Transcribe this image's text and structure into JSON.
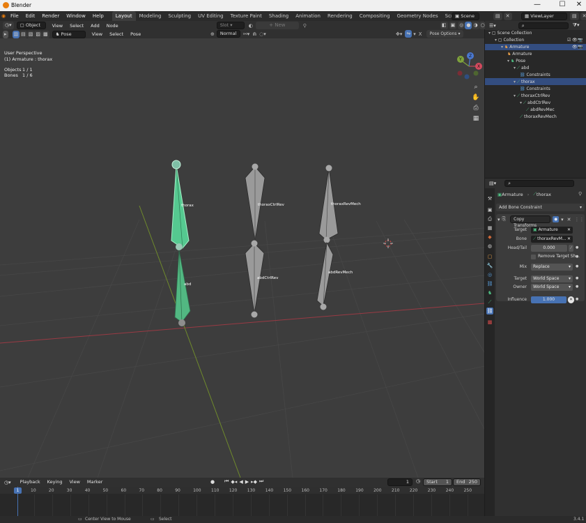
{
  "window": {
    "app_title": "Blender",
    "min": "—",
    "max": "☐",
    "close": "✕"
  },
  "menu": [
    "File",
    "Edit",
    "Render",
    "Window",
    "Help"
  ],
  "workspaces": [
    "Layout",
    "Modeling",
    "Sculpting",
    "UV Editing",
    "Texture Paint",
    "Shading",
    "Animation",
    "Rendering",
    "Compositing",
    "Geometry Nodes",
    "Scripting"
  ],
  "workspace_add": "+",
  "scene": {
    "label": "Scene"
  },
  "view_layer": {
    "label": "ViewLayer"
  },
  "header1": {
    "mode_object": "Object",
    "items": [
      "View",
      "Select",
      "Add",
      "Node"
    ],
    "slot": "Slot",
    "new_btn": "New"
  },
  "header2": {
    "mode": "Pose Mode",
    "items": [
      "View",
      "Select",
      "Pose"
    ],
    "transform": "Normal",
    "x_label": "X",
    "pose_options": "Pose Options"
  },
  "viewport": {
    "perspective": "User Perspective",
    "active": "(1) Armature : thorax",
    "objects_label": "Objects",
    "objects_value": "1 / 1",
    "bones_label": "Bones",
    "bones_value": "1 / 6",
    "bones": [
      "thorax",
      "abd",
      "thoraxCtrlRev",
      "abdCtrlRev",
      "thoraxRevMech",
      "abdRevMech"
    ],
    "gizmo": {
      "x": "X",
      "y": "Y",
      "z": "Z"
    }
  },
  "timeline": {
    "menus": [
      "Playback",
      "Keying",
      "View",
      "Marker"
    ],
    "current_frame": "1",
    "start_label": "Start",
    "start_value": "1",
    "end_label": "End",
    "end_value": "250",
    "ticks": [
      "10",
      "20",
      "30",
      "40",
      "50",
      "60",
      "70",
      "80",
      "90",
      "100",
      "110",
      "120",
      "130",
      "140",
      "150",
      "160",
      "170",
      "180",
      "190",
      "200",
      "210",
      "220",
      "230",
      "240",
      "250"
    ],
    "playhead": "1"
  },
  "statusbar": {
    "hint1": "Center View to Mouse",
    "hint2": "Select",
    "version": "3.4.1"
  },
  "outliner": {
    "items": [
      {
        "label": "Scene Collection",
        "indent": 0
      },
      {
        "label": "Collection",
        "indent": 1
      },
      {
        "label": "Armature",
        "indent": 2
      },
      {
        "label": "Armature",
        "indent": 3
      },
      {
        "label": "Pose",
        "indent": 3
      },
      {
        "label": "abd",
        "indent": 4
      },
      {
        "label": "Constraints",
        "indent": 5
      },
      {
        "label": "thorax",
        "indent": 4
      },
      {
        "label": "Constraints",
        "indent": 5
      },
      {
        "label": "thoraxCtrlRev",
        "indent": 4
      },
      {
        "label": "abdCtrlRev",
        "indent": 5
      },
      {
        "label": "abdRevMec",
        "indent": 6
      },
      {
        "label": "thoraxRevMech",
        "indent": 5
      }
    ]
  },
  "properties": {
    "breadcrumb_armature": "Armature",
    "breadcrumb_sep": "›",
    "breadcrumb_bone": "thorax",
    "add_constraint": "Add Bone Constraint",
    "constraint_name": "Copy Transforms",
    "rows": {
      "target_label": "Target",
      "target_value": "Armature",
      "bone_label": "Bone",
      "bone_value": "thoraxRevM...",
      "headtail_label": "Head/Tail",
      "headtail_value": "0.000",
      "remove_target_shear": "Remove Target Sh...",
      "mix_label": "Mix",
      "mix_value": "Replace",
      "target_space_label": "Target",
      "target_space_value": "World Space",
      "owner_label": "Owner",
      "owner_value": "World Space",
      "influence_label": "Influence",
      "influence_value": "1.000"
    }
  },
  "colors": {
    "accent": "#4772b3",
    "selected_bone": "#4fbf83",
    "active_bone": "#8fe3b1",
    "bone_gray": "#9a9a9a"
  }
}
